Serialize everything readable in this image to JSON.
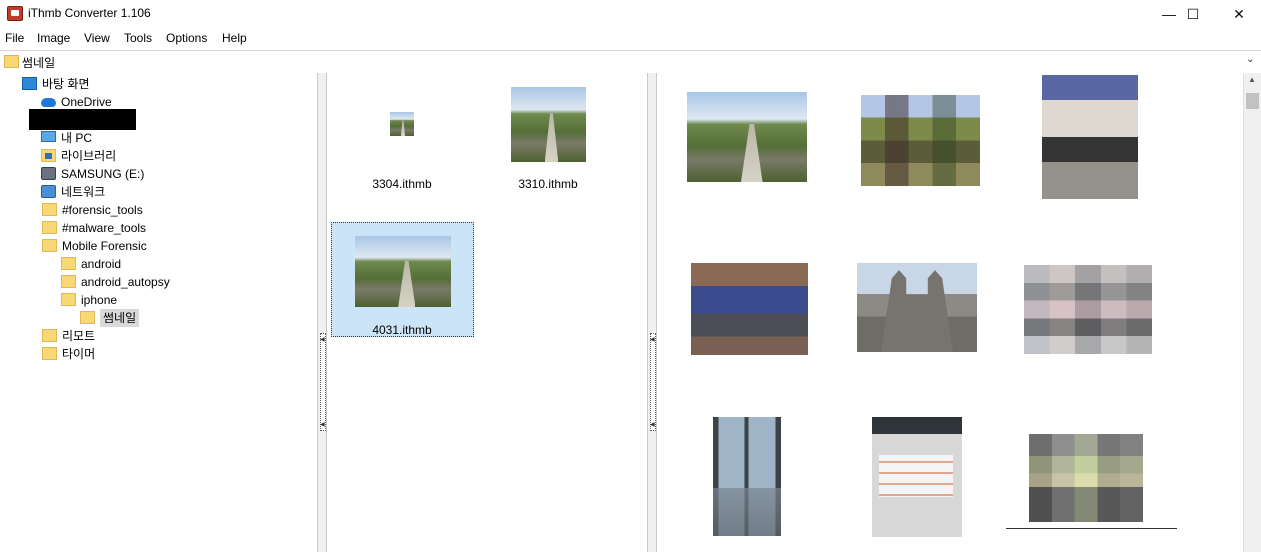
{
  "window": {
    "title": "iThmb Converter 1.106",
    "minimize": "—",
    "maximize": "☐",
    "close": "✕"
  },
  "menu": [
    "File",
    "Image",
    "View",
    "Tools",
    "Options",
    "Help"
  ],
  "address": {
    "path": "썸네일"
  },
  "tree": {
    "items": [
      {
        "label": "바탕 화면",
        "icon": "desktop-icon"
      },
      {
        "label": "OneDrive",
        "icon": "onedrive-icon"
      },
      {
        "label": "내 PC",
        "icon": "pc-icon"
      },
      {
        "label": "라이브러리",
        "icon": "library-icon"
      },
      {
        "label": "SAMSUNG (E:)",
        "icon": "drive-icon"
      },
      {
        "label": "네트워크",
        "icon": "network-icon"
      },
      {
        "label": "#forensic_tools",
        "icon": "folder-icon"
      },
      {
        "label": "#malware_tools",
        "icon": "folder-icon"
      },
      {
        "label": "Mobile Forensic",
        "icon": "folder-icon"
      },
      {
        "label": "android",
        "icon": "folder-icon"
      },
      {
        "label": "android_autopsy",
        "icon": "folder-icon"
      },
      {
        "label": "iphone",
        "icon": "folder-icon"
      },
      {
        "label": "썸네일",
        "icon": "folder-icon",
        "selected": true
      },
      {
        "label": "리모트",
        "icon": "folder-icon"
      },
      {
        "label": "타이머",
        "icon": "folder-icon"
      }
    ]
  },
  "files": [
    {
      "name": "3304.ithmb"
    },
    {
      "name": "3310.ithmb"
    },
    {
      "name": "4031.ithmb",
      "selected": true
    }
  ],
  "colors": {
    "selection": "#cce4f7",
    "tree_selection": "#d9d9d9",
    "folder": "#f8d775"
  }
}
